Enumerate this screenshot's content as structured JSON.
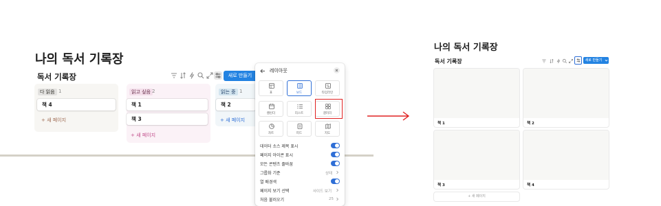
{
  "left": {
    "page_title": "나의 독서 기록장",
    "db_title": "독서 기록장",
    "new_button": "새로 만들기",
    "columns": [
      {
        "status": "다 읽음",
        "count": "1",
        "badge_color": "#e3e2e0",
        "cards": [
          "책 4"
        ],
        "add_label": "새 페이지",
        "add_color": "#9f6b53"
      },
      {
        "status": "읽고 싶음",
        "count": "2",
        "badge_color": "#f4dfeb",
        "cards": [
          "책 1",
          "책 3"
        ],
        "add_label": "새 페이지",
        "add_color": "#c14c8a"
      },
      {
        "status": "읽는 중",
        "count": "1",
        "badge_color": "#d3e5ef",
        "cards": [
          "책 2"
        ],
        "add_label": "새 페이지",
        "add_color": "#2f6fd6"
      }
    ]
  },
  "panel": {
    "title": "레이아웃",
    "layouts": [
      {
        "label": "표",
        "icon": "table-icon",
        "selected": false
      },
      {
        "label": "보드",
        "icon": "board-icon",
        "selected": true
      },
      {
        "label": "타임라인",
        "icon": "timeline-icon",
        "selected": false
      },
      {
        "label": "캘린더",
        "icon": "calendar-icon",
        "selected": false
      },
      {
        "label": "리스트",
        "icon": "list-icon",
        "selected": false
      },
      {
        "label": "갤러리",
        "icon": "gallery-icon",
        "selected": false,
        "highlighted": true
      },
      {
        "label": "차트",
        "icon": "chart-icon",
        "selected": false
      },
      {
        "label": "피드",
        "icon": "feed-icon",
        "selected": false
      },
      {
        "label": "지도",
        "icon": "map-icon",
        "selected": false
      }
    ],
    "options": [
      {
        "label": "데이터 소스 제목 표시",
        "toggle": true
      },
      {
        "label": "페이지 아이콘 표시",
        "toggle": true
      },
      {
        "label": "모든 콘텐츠 줄바꿈",
        "toggle": true
      },
      {
        "label": "그룹화 기준",
        "value": "상태"
      },
      {
        "label": "열 배경색",
        "toggle": true
      },
      {
        "label": "페이지 보기 선택",
        "value": "사이드 보기"
      },
      {
        "label": "처음 불러오기",
        "value": "25"
      }
    ]
  },
  "arrow_color": "#e02020",
  "right": {
    "page_title": "나의 독서 기록장",
    "db_title": "독서 기록장",
    "new_button": "새로 만들기",
    "cards": [
      "책 1",
      "책 2",
      "책 3",
      "책 4"
    ],
    "add_label": "+ 새 페이지"
  }
}
